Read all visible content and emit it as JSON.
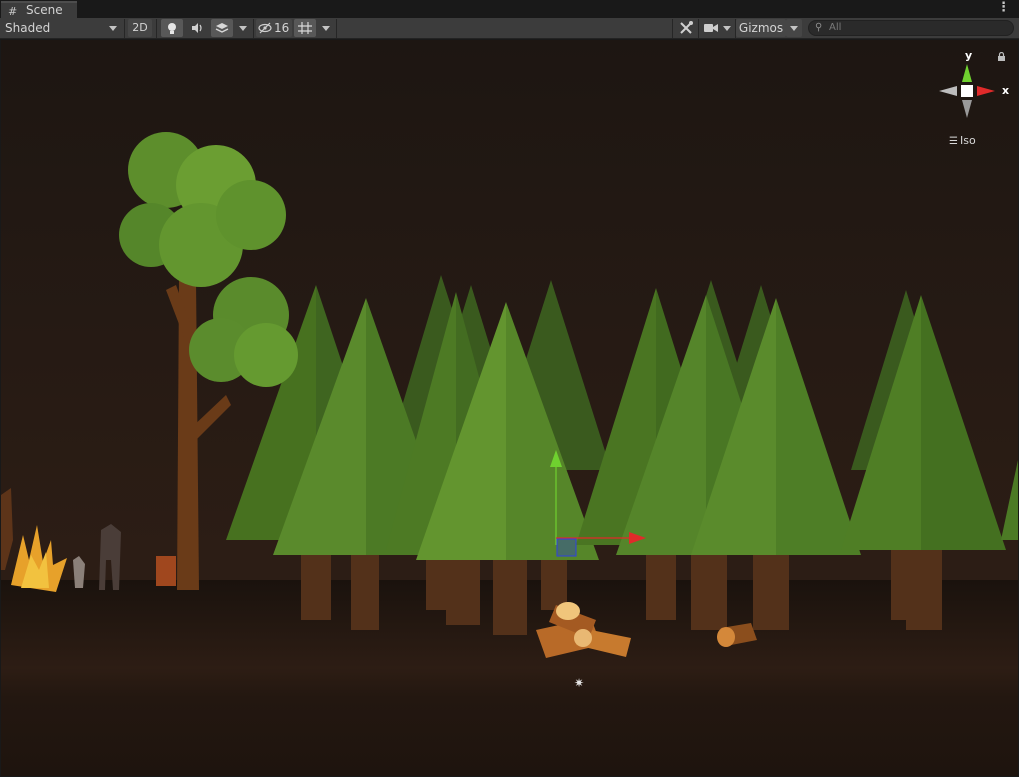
{
  "window": {
    "tab_label": "Scene",
    "tab_icon": "grid-icon",
    "more_icon": "kebab-menu-icon"
  },
  "toolbar": {
    "shading_mode": "Shaded",
    "mode_2d": "2D",
    "lighting_icon": "lightbulb-icon",
    "audio_icon": "speaker-icon",
    "effects_icon": "layers-icon",
    "hidden_count": "16",
    "hidden_icon": "eye-slash-icon",
    "grid_icon": "grid-snap-icon",
    "tools_icon": "tools-icon",
    "camera_icon": "camera-icon",
    "gizmos_label": "Gizmos",
    "search_placeholder": "All"
  },
  "scene_gizmo": {
    "y_label": "y",
    "x_label": "x",
    "projection": "Iso",
    "lock_icon": "lock-icon"
  },
  "colors": {
    "editor_bg": "#191919",
    "toolbar_bg": "#3c3c3c",
    "scene_bg": "#2a1c15",
    "ground": "#1f150f",
    "pine_light": "#5f8f2e",
    "pine_dark": "#3b5f1f",
    "trunk": "#5a3418",
    "axis_y": "#6fd12f",
    "axis_x": "#e02a2a"
  }
}
